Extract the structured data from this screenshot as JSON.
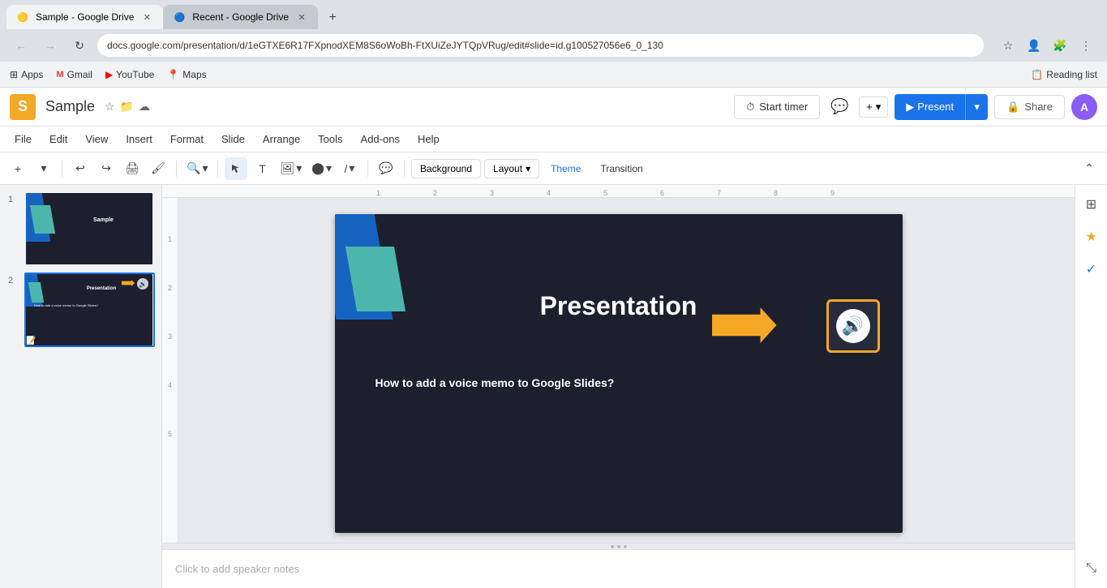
{
  "browser": {
    "tabs": [
      {
        "id": "tab1",
        "title": "Sample - Google Drive",
        "favicon": "🟡",
        "active": true
      },
      {
        "id": "tab2",
        "title": "Recent - Google Drive",
        "favicon": "🟦",
        "active": false
      }
    ],
    "address": "docs.google.com/presentation/d/1eGTXE6R17FXpnodXEM8S6oWoBh-FtXUiZeJYTQpVRug/edit#slide=id.g100527056e6_0_130",
    "new_tab_label": "+",
    "bookmarks": [
      {
        "label": "Apps",
        "icon": "⊞"
      },
      {
        "label": "Gmail",
        "icon": "M"
      },
      {
        "label": "YouTube",
        "icon": "▶"
      },
      {
        "label": "Maps",
        "icon": "📍"
      }
    ],
    "reading_list_label": "Reading list"
  },
  "app": {
    "logo_letter": "S",
    "title": "Sample",
    "menu_items": [
      "File",
      "Edit",
      "View",
      "Insert",
      "Format",
      "Slide",
      "Arrange",
      "Tools",
      "Add-ons",
      "Help"
    ],
    "start_timer_label": "Start timer",
    "present_label": "Present",
    "share_label": "Share",
    "user_initial": "A"
  },
  "toolbar": {
    "background_label": "Background",
    "layout_label": "Layout",
    "theme_label": "Theme",
    "transition_label": "Transition"
  },
  "slides": [
    {
      "number": "1",
      "title": "Sample",
      "active": false
    },
    {
      "number": "2",
      "title": "Presentation",
      "subtitle": "How to add a voice memo to Google Slides?",
      "active": true
    }
  ],
  "canvas": {
    "slide_title": "Presentation",
    "slide_subtitle": "How to add a voice memo to Google Slides?"
  },
  "notes": {
    "placeholder": "Click to add speaker notes"
  }
}
